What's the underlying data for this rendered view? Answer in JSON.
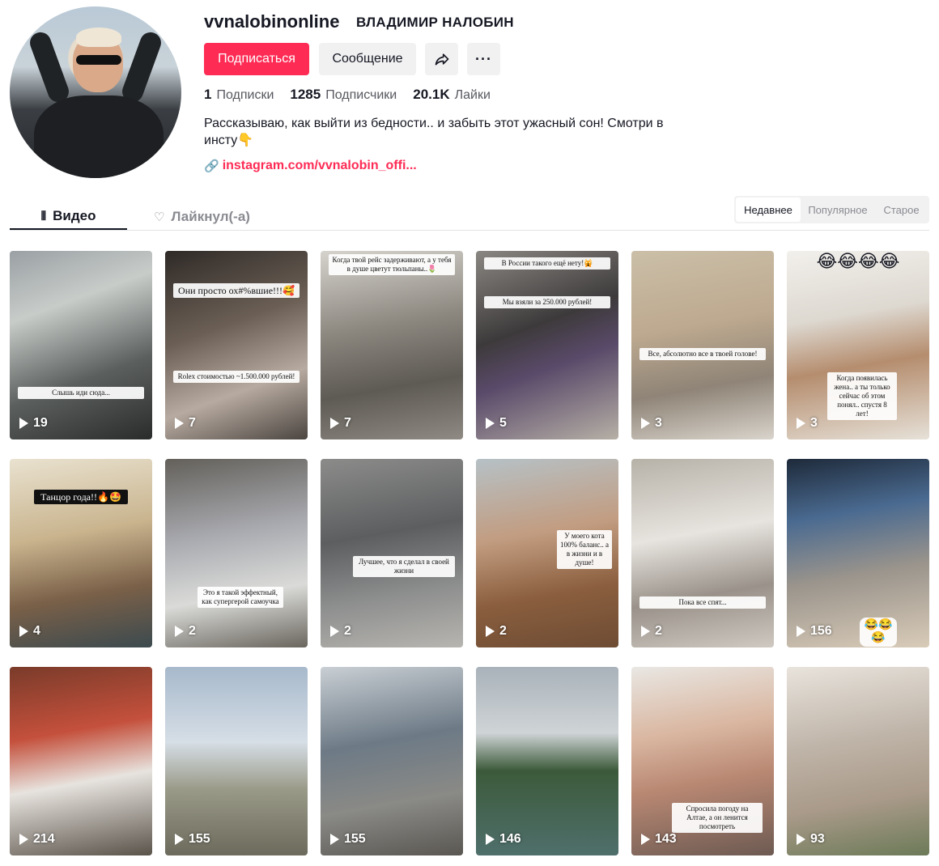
{
  "profile": {
    "username": "vvnalobinonline",
    "fullname": "ВЛАДИМИР НАЛОБИН",
    "bio": "Рассказываю, как выйти из бедности.. и забыть этот ужасный сон! Смотри в инсту👇",
    "link": "instagram.com/vvnalobin_offi..."
  },
  "buttons": {
    "follow": "Подписаться",
    "message": "Сообщение",
    "more": "···"
  },
  "stats": {
    "following_count": "1",
    "following_label": "Подписки",
    "followers_count": "1285",
    "followers_label": "Подписчики",
    "likes_count": "20.1K",
    "likes_label": "Лайки"
  },
  "tabs": {
    "videos": "Видео",
    "liked": "Лайкнул(-а)"
  },
  "sort": {
    "recent": "Недавнее",
    "popular": "Популярное",
    "old": "Старое"
  },
  "videos": [
    {
      "views": "19",
      "caption": "Слышь иди сюда..."
    },
    {
      "views": "7",
      "caption_top": "Они просто ох#%вшие!!!🥰",
      "caption": "Rolex стоимостью ~1.500.000 рублей!"
    },
    {
      "views": "7",
      "caption_top": "Когда твой рейс задерживают, а у тебя в душе цветут тюльпаны..🌷"
    },
    {
      "views": "5",
      "caption_top": "В России такого ещё нету!🙀",
      "caption": "Мы взяли за 250.000 рублей!"
    },
    {
      "views": "3",
      "caption": "Все, абсолютно все в твоей голове!"
    },
    {
      "views": "3",
      "emoji": "😂😂😂😂",
      "caption": "Когда появилась жена.. а ты только сейчас об этом понял.. спустя 8 лет!"
    },
    {
      "views": "4",
      "caption_top": "Танцор года!!🔥🤩"
    },
    {
      "views": "2",
      "caption": "Это я такой эффектный, как супергерой самоучка"
    },
    {
      "views": "2",
      "caption": "Лучшее, что я сделал в своей жизни"
    },
    {
      "views": "2",
      "caption": "У моего кота 100% баланс.. а в жизни и в душе!"
    },
    {
      "views": "2",
      "caption": "Пока все спят..."
    },
    {
      "views": "156",
      "emoji_bottom": "😂😂😂"
    },
    {
      "views": "214"
    },
    {
      "views": "155"
    },
    {
      "views": "155"
    },
    {
      "views": "146"
    },
    {
      "views": "143",
      "caption": "Спросила погоду на Алтае, а он ленится посмотреть"
    },
    {
      "views": "93"
    }
  ],
  "colors": {
    "accent": "#fe2c55",
    "secondary_button_bg": "#f1f1f2",
    "text_primary": "#161823",
    "text_secondary": "#57585f"
  }
}
